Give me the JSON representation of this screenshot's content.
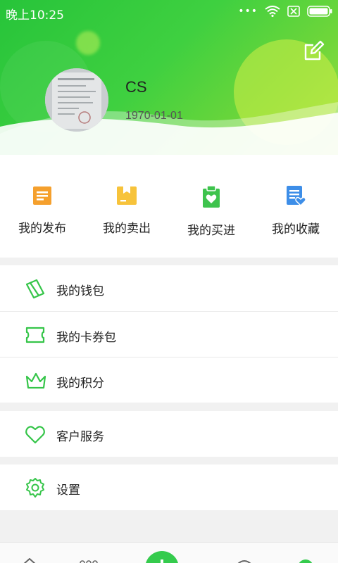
{
  "status_bar": {
    "time": "晚上10:25"
  },
  "profile": {
    "nickname": "CS",
    "birthday": "1970-01-01"
  },
  "orders": [
    {
      "label": "我的发布",
      "icon": "publish-icon",
      "color": "#f5a02d"
    },
    {
      "label": "我的卖出",
      "icon": "sold-box-icon",
      "color": "#f7c33b"
    },
    {
      "label": "我的买进",
      "icon": "clipboard-heart-icon",
      "color": "#3ec34d"
    },
    {
      "label": "我的收藏",
      "icon": "favorite-doc-icon",
      "color": "#3d8ee8"
    }
  ],
  "menu": {
    "wallet": "我的钱包",
    "coupons": "我的卡券包",
    "points": "我的积分",
    "service": "客户服务",
    "settings": "设置"
  },
  "colors": {
    "accent": "#2fc744",
    "icon_green": "#35c549"
  }
}
